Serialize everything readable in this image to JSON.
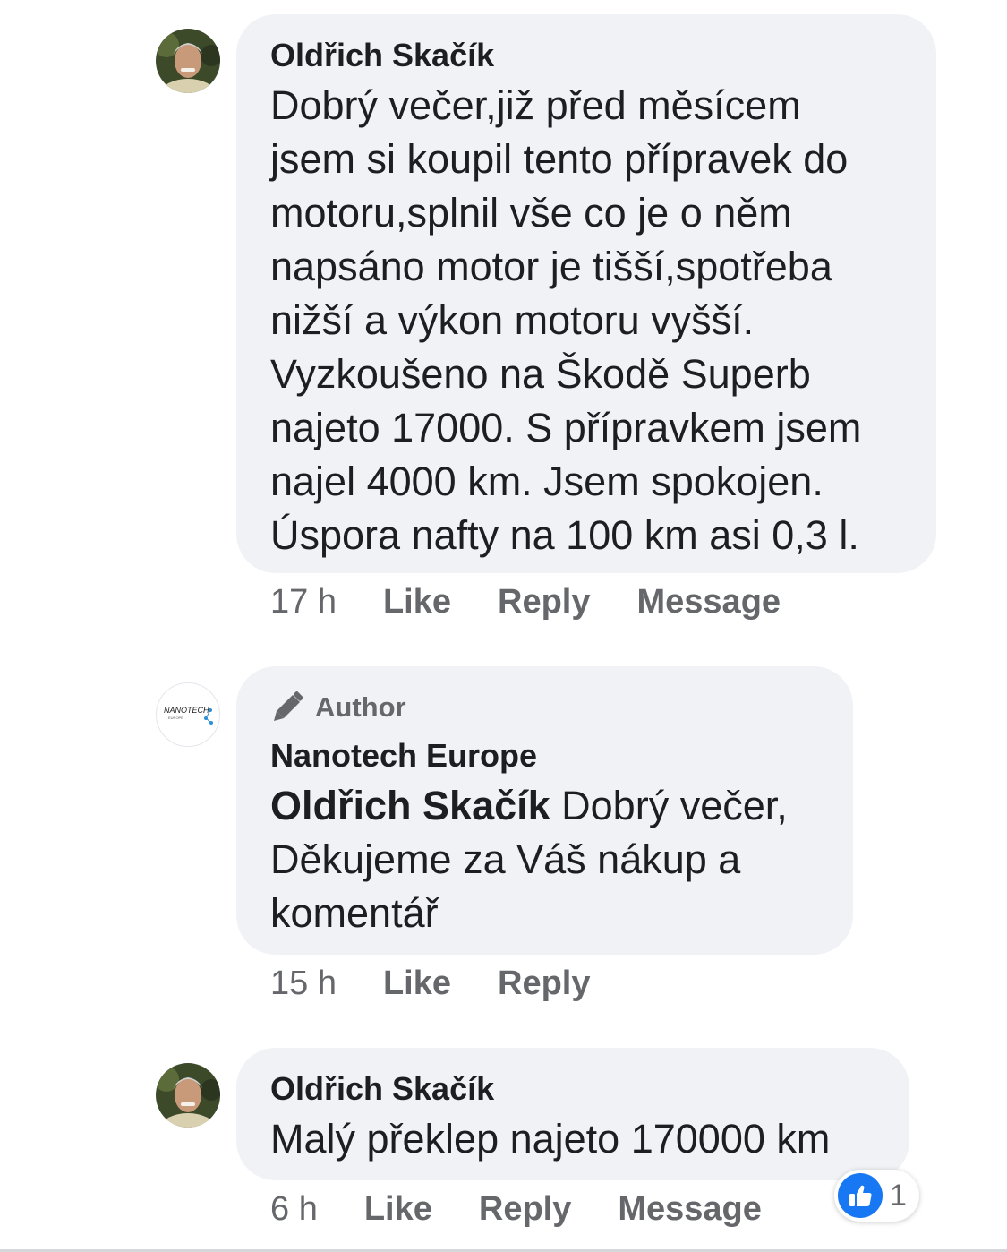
{
  "comments": [
    {
      "author": "Oldřich Skačík",
      "text": "Dobrý večer,již před měsícem\njsem si koupil tento přípravek do\nmotoru,splnil vše co je o něm\nnapsáno motor je tišší,spotřeba\nnižší a výkon motoru vyšší.\nVyzkoušeno na Škodě Superb\nnajeto 17000. S přípravkem jsem\nnajel 4000 km. Jsem spokojen.\nÚspora nafty na 100 km asi 0,3 l.",
      "time": "17 h",
      "like": "Like",
      "reply": "Reply",
      "message": "Message"
    },
    {
      "badge": "Author",
      "author": "Nanotech Europe",
      "mention": "Oldřich Skačík",
      "text": " Dobrý večer,\nDěkujeme za Váš nákup a\nkomentář",
      "time": "15 h",
      "like": "Like",
      "reply": "Reply",
      "logo_text": "NANOTECH",
      "logo_sub": "EUROPE"
    },
    {
      "author": "Oldřich Skačík",
      "text": "Malý překlep najeto 170000 km",
      "time": "6 h",
      "like": "Like",
      "reply": "Reply",
      "message": "Message",
      "reaction_count": "1"
    }
  ],
  "colors": {
    "bubble": "#f0f2f5",
    "secondary_text": "#65676b",
    "like_blue": "#1877f2"
  },
  "icons": [
    "avatar-photo",
    "pencil-icon",
    "thumbs-up-icon"
  ]
}
